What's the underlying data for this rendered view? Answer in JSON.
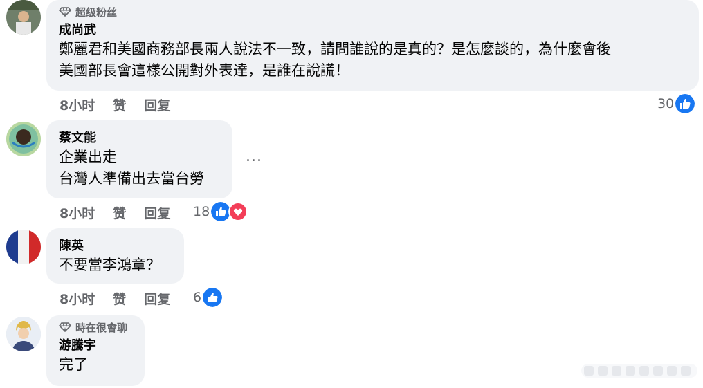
{
  "comments": [
    {
      "badge": "超级粉丝",
      "author": "成尚武",
      "text_lines": [
        "鄭麗君和美國商務部長兩人說法不一致，請問誰說的是真的？是怎麼談的，為什麼會後",
        "美國部長會這樣公開對外表達，是誰在說謊！"
      ],
      "time": "8小时",
      "like_label": "赞",
      "reply_label": "回复",
      "reaction_count": "30",
      "reactions": [
        "like"
      ]
    },
    {
      "author": "蔡文能",
      "text_lines": [
        "企業出走",
        "台灣人準備出去當台勞"
      ],
      "time": "8小时",
      "like_label": "赞",
      "reply_label": "回复",
      "reaction_count": "18",
      "reactions": [
        "like",
        "love"
      ],
      "more_label": "..."
    },
    {
      "author": "陳英",
      "text_lines": [
        "不要當李鴻章？"
      ],
      "time": "8小时",
      "like_label": "赞",
      "reply_label": "回复",
      "reaction_count": "6",
      "reactions": [
        "like"
      ]
    },
    {
      "badge": "時在很會聊",
      "author": "游騰宇",
      "text_lines": [
        "完了"
      ]
    }
  ],
  "colors": {
    "bubble": "#f0f2f5",
    "meta_text": "#65676b",
    "like_blue": "#1877f2",
    "love_red": "#f33e58"
  }
}
